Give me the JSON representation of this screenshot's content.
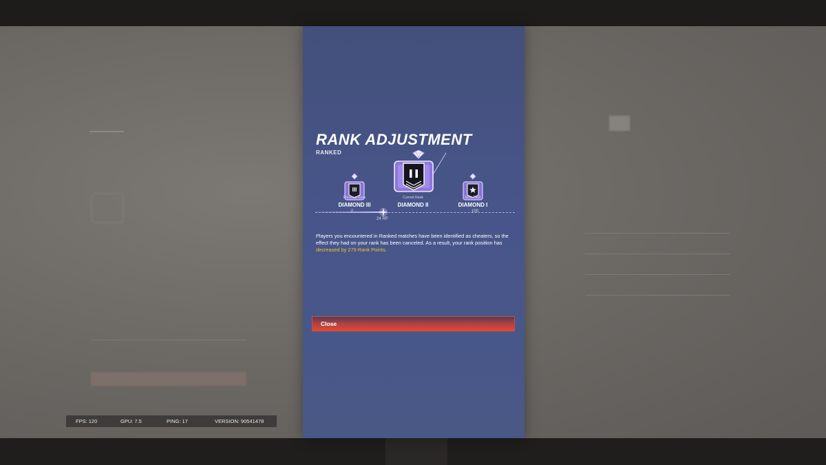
{
  "modal": {
    "title": "RANK ADJUSTMENT",
    "subtitle": "RANKED",
    "ranks": {
      "previous": {
        "caption": "Previous Rank",
        "name": "DIAMOND III",
        "numeral": "III"
      },
      "current": {
        "caption": "Current Rank",
        "name": "DIAMOND II",
        "numeral": "II"
      },
      "next": {
        "caption": "Next Rank",
        "name": "DIAMOND I",
        "numeral": "I"
      }
    },
    "progress": {
      "min_label": "0",
      "max_label": "100",
      "current_label": "24 RP",
      "value": 24
    },
    "message_part1": "Players you encountered in Ranked matches have been identified as cheaters, so the effect they had on your rank has been canceled. As a result, your rank position has ",
    "message_highlight": "decreased by 279 Rank Points",
    "message_part2": ".",
    "close_label": "Close"
  },
  "status": {
    "fps": "FPS: 120",
    "gpu": "GPU: 7.5",
    "ping": "PING: 17",
    "version": "VERSION: 90541478"
  },
  "colors": {
    "modal_bg": "#47558a",
    "highlight": "#f2c230",
    "close_button": "#e24733",
    "rank_accent": "#a98ee8"
  }
}
